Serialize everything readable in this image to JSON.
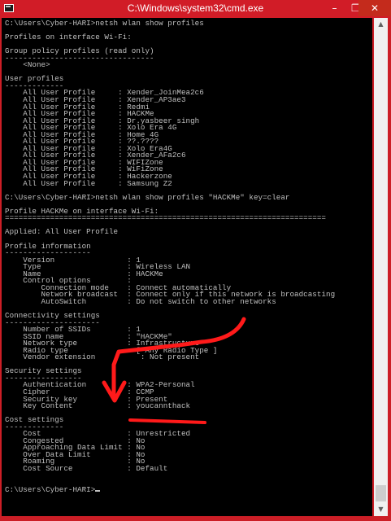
{
  "window": {
    "title": "C:\\Windows\\system32\\cmd.exe",
    "min_glyph": "–",
    "max_glyph": "❐",
    "close_glyph": "✕"
  },
  "console": {
    "lines": [
      "C:\\Users\\Cyber-HARI>netsh wlan show profiles",
      "",
      "Profiles on interface Wi-Fi:",
      "",
      "Group policy profiles (read only)",
      "---------------------------------",
      "    <None>",
      "",
      "User profiles",
      "-------------",
      "    All User Profile     : Xender_JoinMea2c6",
      "    All User Profile     : Xender_AP3ae3",
      "    All User Profile     : Redmi",
      "    All User Profile     : HACKMe",
      "    All User Profile     : Dr.yasbeer singh",
      "    All User Profile     : Xolo Era 4G",
      "    All User Profile     : Home 4G",
      "    All User Profile     : ??.????",
      "    All User Profile     : Xolo Era4G",
      "    All User Profile     : Xender_AFa2c6",
      "    All User Profile     : WIFIZone",
      "    All User Profile     : WiFiZone",
      "    All User Profile     : Hackerzone",
      "    All User Profile     : Samsung Z2",
      "",
      "C:\\Users\\Cyber-HARI>netsh wlan show profiles \"HACKMe\" key=clear",
      "",
      "Profile HACKMe on interface Wi-Fi:",
      "=======================================================================",
      "",
      "Applied: All User Profile",
      "",
      "Profile information",
      "-------------------",
      "    Version                : 1",
      "    Type                   : Wireless LAN",
      "    Name                   : HACKMe",
      "    Control options        :",
      "        Connection mode    : Connect automatically",
      "        Network broadcast  : Connect only if this network is broadcasting",
      "        AutoSwitch         : Do not switch to other networks",
      "",
      "Connectivity settings",
      "---------------------",
      "    Number of SSIDs        : 1",
      "    SSID name              : \"HACKMe\"",
      "    Network type           : Infrastructure",
      "    Radio type             : [ Any Radio Type ]",
      "    Vendor extension          : Not present",
      "",
      "Security settings",
      "-----------------",
      "    Authentication         : WPA2-Personal",
      "    Cipher                 : CCMP",
      "    Security key           : Present",
      "    Key Content            : youcannthack",
      "",
      "Cost settings",
      "-------------",
      "    Cost                   : Unrestricted",
      "    Congested              : No",
      "    Approaching Data Limit : No",
      "    Over Data Limit        : No",
      "    Roaming                : No",
      "    Cost Source            : Default",
      "",
      "",
      "C:\\Users\\Cyber-HARI>"
    ]
  },
  "annotation": {
    "color": "#ff1a1a"
  },
  "scrollbar": {
    "up_glyph": "▲",
    "down_glyph": "▼"
  }
}
